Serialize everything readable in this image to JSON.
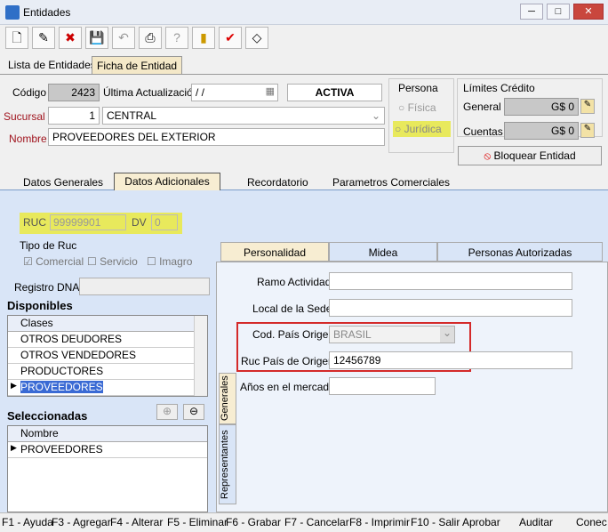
{
  "window": {
    "title": "Entidades",
    "minimize": "─",
    "maximize": "□",
    "close": "✕"
  },
  "toolbar": {
    "buttons": [
      {
        "name": "new-button",
        "glyph": "🗋"
      },
      {
        "name": "edit-button",
        "glyph": "✎"
      },
      {
        "name": "delete-button",
        "glyph": "✖"
      },
      {
        "name": "save-button",
        "glyph": "💾"
      },
      {
        "name": "undo-button",
        "glyph": "↶"
      },
      {
        "name": "print-button",
        "glyph": "⎙"
      },
      {
        "name": "help-button",
        "glyph": "?"
      },
      {
        "name": "exit-button",
        "glyph": "▮"
      },
      {
        "name": "confirm-button",
        "glyph": "✔"
      },
      {
        "name": "clear-button",
        "glyph": "◇"
      }
    ]
  },
  "top_tabs": [
    "Lista de Entidades",
    "Ficha de Entidad"
  ],
  "header": {
    "codigo_label": "Código",
    "codigo_value": "2423",
    "ultima_label": "Última Actualización",
    "ultima_value": "/  /",
    "status": "ACTIVA",
    "sucursal_label": "Sucursal",
    "sucursal_num": "1",
    "sucursal_name": "CENTRAL",
    "nombre_label": "Nombre",
    "nombre_value": "PROVEEDORES DEL EXTERIOR",
    "persona_label": "Persona",
    "fisica": "Física",
    "juridica": "Jurídica",
    "limites_label": "Límites Crédito",
    "general_label": "General",
    "general_value": "G$ 0",
    "cuentas_label": "Cuentas",
    "cuentas_value": "G$ 0",
    "bloquear": "Bloquear Entidad"
  },
  "section_tabs": [
    "Datos Generales",
    "Datos Adicionales",
    "Recordatorio",
    "Parametros Comerciales"
  ],
  "adicionales": {
    "ruc_label": "RUC",
    "ruc_value": "99999901",
    "dv_label": "DV",
    "dv_value": "0",
    "tipo_ruc_label": "Tipo de Ruc",
    "tipo_options": [
      "Comercial",
      "Servicio",
      "Imagro"
    ],
    "registro_label": "Registro DNA",
    "disponibles_label": "Disponibles",
    "clases_header": "Clases",
    "disponibles": [
      "OTROS DEUDORES",
      "OTROS VENDEDORES",
      "PRODUCTORES",
      "PROVEEDORES"
    ],
    "seleccionadas_label": "Seleccionadas",
    "nombre_header": "Nombre",
    "seleccionadas": [
      "PROVEEDORES"
    ]
  },
  "right_tabs": [
    "Personalidad",
    "Midea",
    "Personas Autorizadas"
  ],
  "vertical_tabs": [
    "Generales",
    "Representantes"
  ],
  "personalidad": {
    "ramo_label": "Ramo Actividad",
    "local_label": "Local de la Sede",
    "cod_pais_label": "Cod. País Origen",
    "cod_pais_value": "BRASIL",
    "ruc_pais_label": "Ruc País de Origen",
    "ruc_pais_value": "12456789",
    "anos_label": "Años en el mercado"
  },
  "statusbar": [
    "F1 - Ayuda",
    "F3 - Agregar",
    "F4 - Alterar",
    "F5 - Eliminar",
    "F6 - Grabar",
    "F7 - Cancelar",
    "F8 - Imprimir",
    "F10 - Salir",
    "Aprobar",
    "Auditar",
    "Conec"
  ]
}
